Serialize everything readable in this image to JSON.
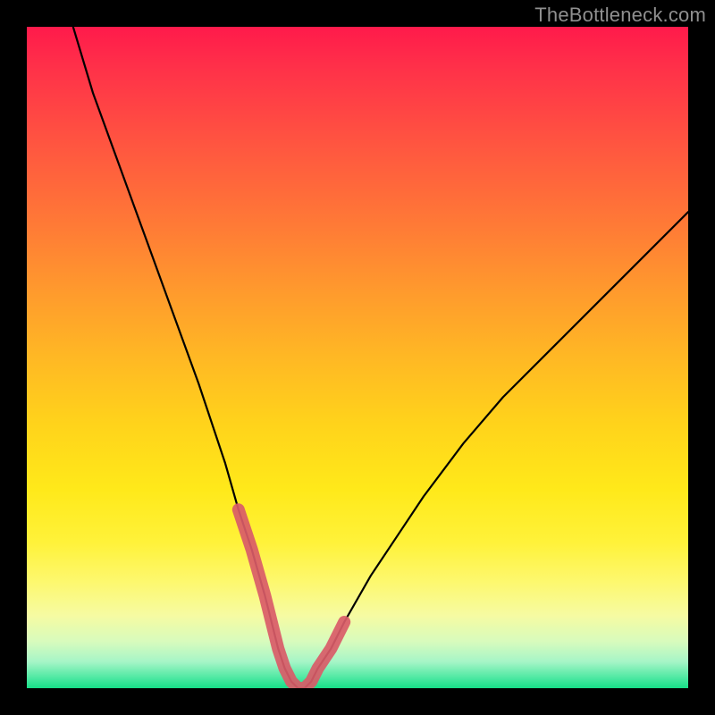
{
  "watermark": "TheBottleneck.com",
  "chart_data": {
    "type": "line",
    "title": "",
    "xlabel": "",
    "ylabel": "",
    "xlim": [
      0,
      100
    ],
    "ylim": [
      0,
      100
    ],
    "background_gradient": {
      "top_color": "#ff1a4b",
      "mid_color": "#ffe91a",
      "bottom_color": "#17de87"
    },
    "series": [
      {
        "name": "bottleneck-curve",
        "x": [
          7,
          10,
          14,
          18,
          22,
          26,
          30,
          32,
          34,
          36,
          37,
          38,
          39,
          40,
          41,
          42,
          43,
          44,
          46,
          48,
          52,
          56,
          60,
          66,
          72,
          80,
          90,
          100
        ],
        "values": [
          100,
          90,
          79,
          68,
          57,
          46,
          34,
          27,
          21,
          14,
          10,
          6,
          3,
          1,
          0,
          0,
          1,
          3,
          6,
          10,
          17,
          23,
          29,
          37,
          44,
          52,
          62,
          72
        ]
      },
      {
        "name": "highlight-band",
        "x": [
          32,
          34,
          36,
          37,
          38,
          39,
          40,
          41,
          42,
          43,
          44,
          46,
          48
        ],
        "values": [
          27,
          21,
          14,
          10,
          6,
          3,
          1,
          0,
          0,
          1,
          3,
          6,
          10
        ]
      }
    ],
    "annotations": []
  }
}
